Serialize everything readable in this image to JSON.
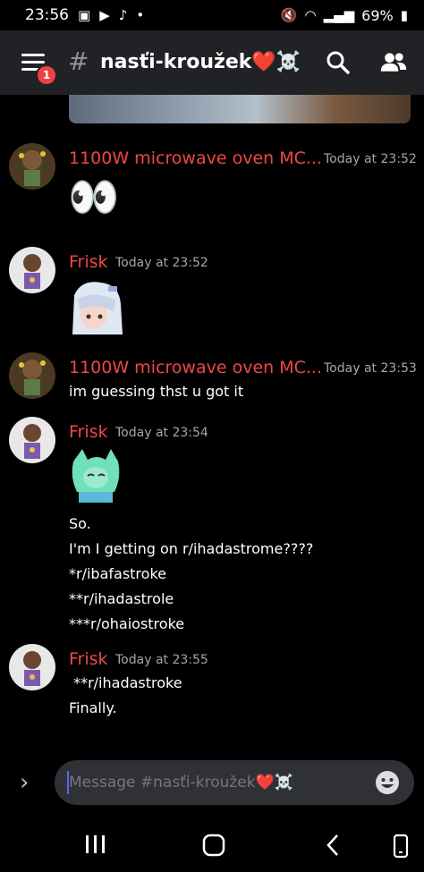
{
  "status_bar": {
    "time": "23:56",
    "battery": "69%"
  },
  "header": {
    "badge": "1",
    "hash": "#",
    "channel_name": "nasťi-kroužek❤️☠️"
  },
  "messages": [
    {
      "author": "1100W microwave oven MC...",
      "time": "Today at 23:52",
      "lines": [],
      "content": "👀"
    },
    {
      "author": "Frisk",
      "time": "Today at 23:52",
      "lines": [],
      "content": "sticker"
    },
    {
      "author": "1100W microwave oven MC...",
      "time": "Today at 23:53",
      "lines": [
        "im guessing thst u got it"
      ]
    },
    {
      "author": "Frisk",
      "time": "Today at 23:54",
      "lines": [
        "So.",
        "I'm I getting on r/ihadastrome????",
        "*r/ibafastroke",
        "**r/ihadastrole",
        "***r/ohaiostroke"
      ]
    },
    {
      "author": "Frisk",
      "time": "Today at 23:55",
      "lines": [
        " **r/ihadastroke",
        "Finally."
      ]
    }
  ],
  "composer": {
    "placeholder": "Message #nasťi-kroužek❤️☠️"
  },
  "colors": {
    "author": "#f04747",
    "header_bg": "#202225",
    "input_bg": "#2f3136",
    "accent": "#5865f2"
  }
}
